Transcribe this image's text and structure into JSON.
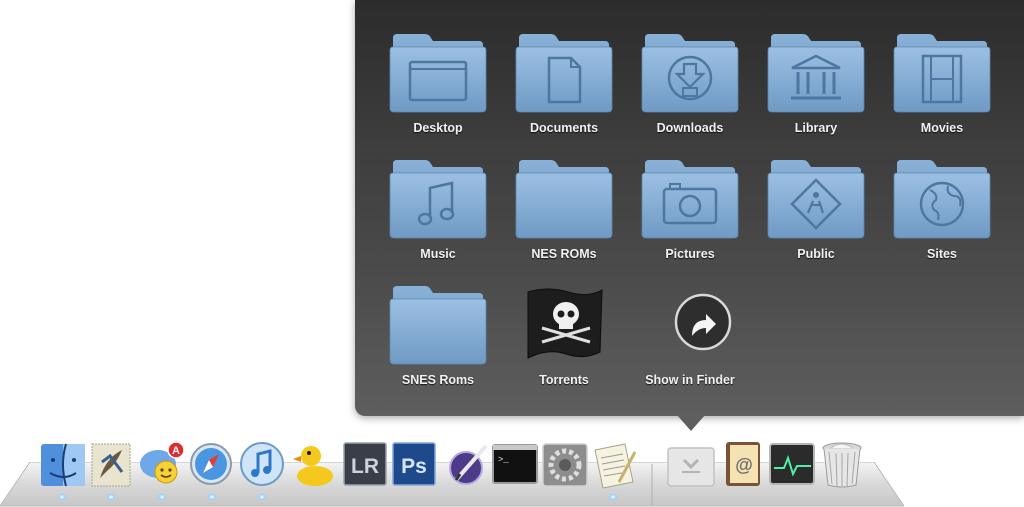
{
  "stack": {
    "items": [
      {
        "label": "Desktop",
        "icon": "desktop-folder-icon"
      },
      {
        "label": "Documents",
        "icon": "documents-folder-icon"
      },
      {
        "label": "Downloads",
        "icon": "downloads-folder-icon"
      },
      {
        "label": "Library",
        "icon": "library-folder-icon"
      },
      {
        "label": "Movies",
        "icon": "movies-folder-icon"
      },
      {
        "label": "Music",
        "icon": "music-folder-icon"
      },
      {
        "label": "NES ROMs",
        "icon": "folder-icon"
      },
      {
        "label": "Pictures",
        "icon": "pictures-folder-icon"
      },
      {
        "label": "Public",
        "icon": "public-folder-icon"
      },
      {
        "label": "Sites",
        "icon": "sites-folder-icon"
      },
      {
        "label": "SNES Roms",
        "icon": "folder-icon"
      },
      {
        "label": "Torrents",
        "icon": "pirate-flag-icon"
      },
      {
        "label": "Show in Finder",
        "icon": "show-in-finder-icon"
      }
    ]
  },
  "dock": {
    "apps": [
      {
        "icon": "finder-icon",
        "running": true
      },
      {
        "icon": "mail-icon",
        "running": true
      },
      {
        "icon": "adium-icon",
        "running": true,
        "badge": "A"
      },
      {
        "icon": "safari-icon",
        "running": true
      },
      {
        "icon": "itunes-icon",
        "running": true
      },
      {
        "icon": "cyberduck-icon",
        "running": false
      },
      {
        "icon": "lightroom-icon",
        "running": false,
        "text": "LR"
      },
      {
        "icon": "photoshop-icon",
        "running": false,
        "text": "Ps"
      },
      {
        "icon": "pen-app-icon",
        "running": false
      },
      {
        "icon": "terminal-icon",
        "running": false
      },
      {
        "icon": "system-preferences-icon",
        "running": false
      },
      {
        "icon": "textedit-icon",
        "running": true
      },
      {
        "icon": "downloads-stack-icon",
        "running": false
      },
      {
        "icon": "address-book-icon",
        "running": false
      },
      {
        "icon": "activity-monitor-icon",
        "running": false
      },
      {
        "icon": "trash-icon",
        "running": false
      }
    ]
  },
  "colors": {
    "folder": "#7fa8cf",
    "panel_top": "#2c2c2c",
    "panel_bottom": "#5e5e5e",
    "dot": "#8fd0ff"
  }
}
